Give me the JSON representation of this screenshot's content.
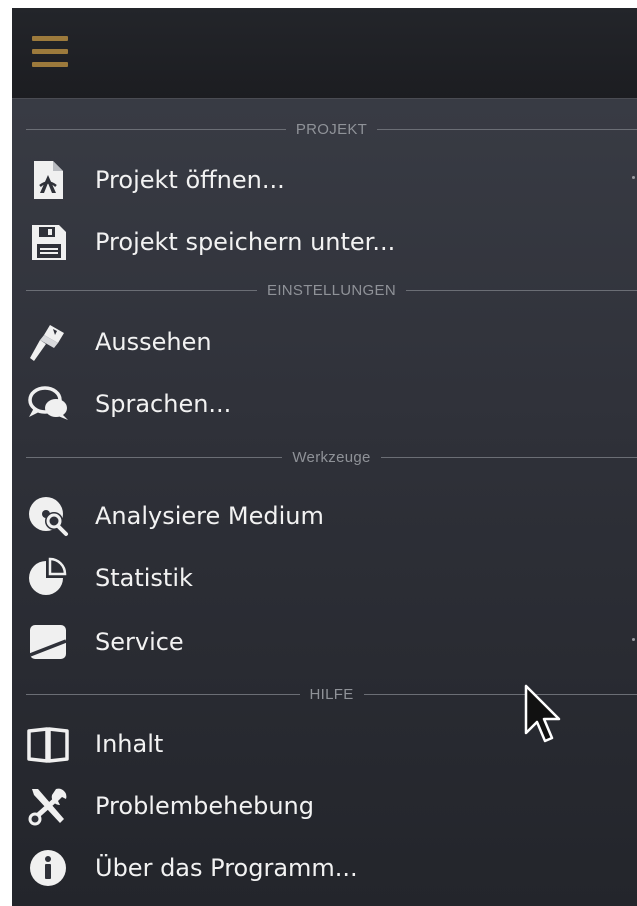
{
  "menu": {
    "sections": [
      {
        "title": "PROJEKT",
        "items": [
          {
            "label": "Projekt öffnen...",
            "icon": "open-project-icon",
            "has_submenu": true
          },
          {
            "label": "Projekt speichern unter...",
            "icon": "save-floppy-icon",
            "has_submenu": false
          }
        ]
      },
      {
        "title": "EINSTELLUNGEN",
        "items": [
          {
            "label": "Aussehen",
            "icon": "paintbrush-icon",
            "has_submenu": false
          },
          {
            "label": "Sprachen...",
            "icon": "speech-bubbles-icon",
            "has_submenu": false
          }
        ]
      },
      {
        "title": "Werkzeuge",
        "items": [
          {
            "label": "Analysiere Medium",
            "icon": "disc-magnifier-icon",
            "has_submenu": false
          },
          {
            "label": "Statistik",
            "icon": "pie-chart-icon",
            "has_submenu": false
          },
          {
            "label": "Service",
            "icon": "service-icon",
            "has_submenu": true
          }
        ]
      },
      {
        "title": "HILFE",
        "items": [
          {
            "label": "Inhalt",
            "icon": "book-icon",
            "has_submenu": false
          },
          {
            "label": "Problembehebung",
            "icon": "tools-icon",
            "has_submenu": false
          },
          {
            "label": "Über das Programm...",
            "icon": "info-icon",
            "has_submenu": false
          }
        ]
      }
    ]
  },
  "colors": {
    "accent_hamburger": "#9c7a3c",
    "menu_text": "#f2f2f2",
    "section_text": "#8f9298"
  }
}
